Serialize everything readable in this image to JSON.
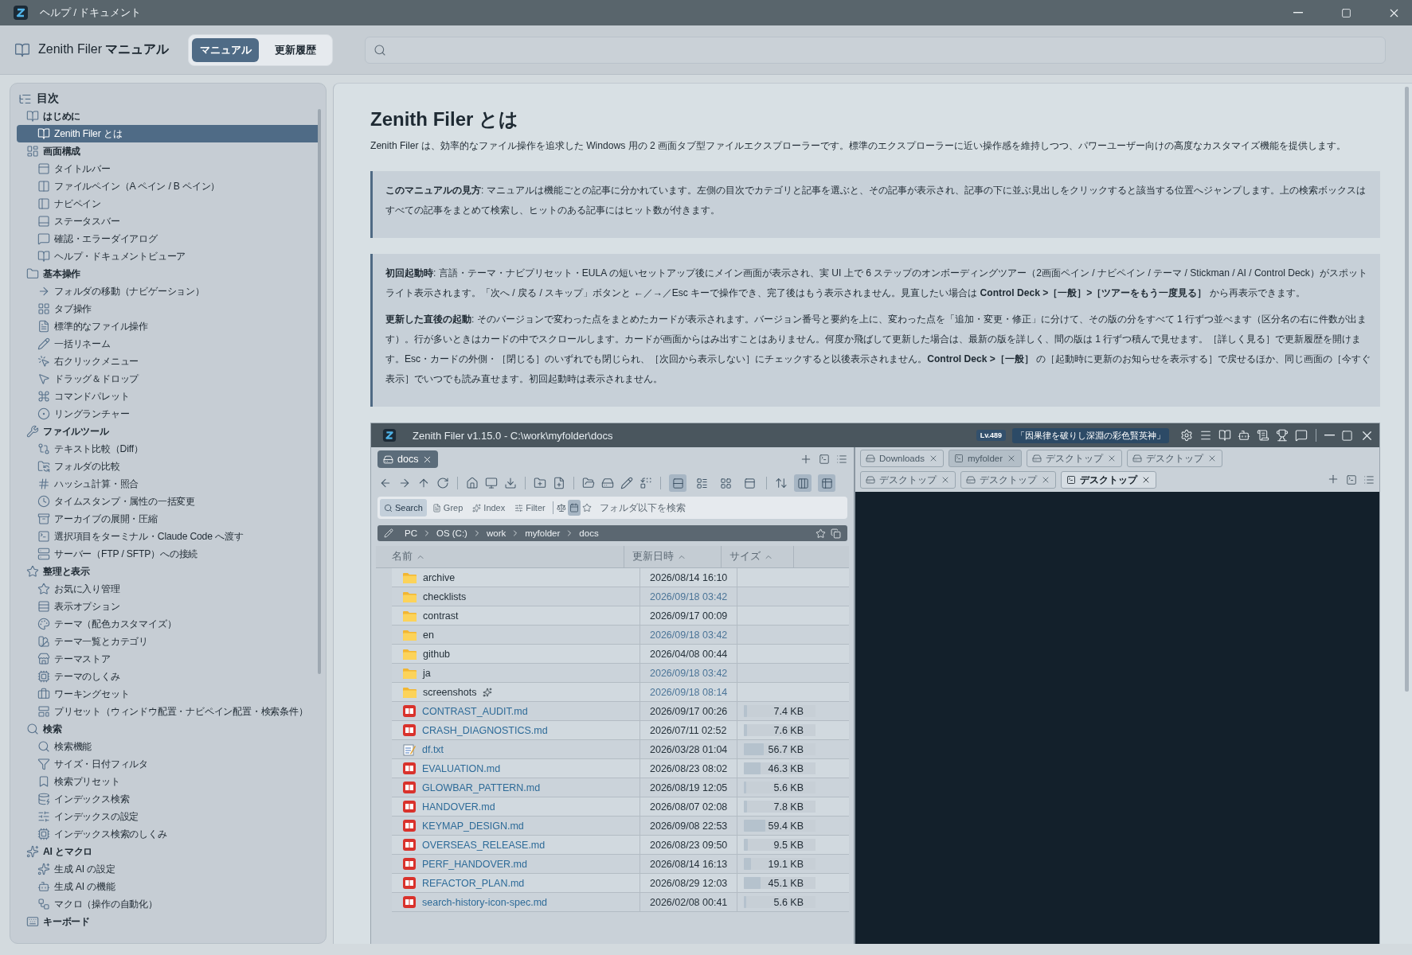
{
  "window": {
    "title": "ヘルプ / ドキュメント"
  },
  "header": {
    "title": "Zenith Filer **マニュアル**"
  },
  "tabs": [
    {
      "label": "マニュアル",
      "selected": true
    },
    {
      "label": "更新履歴",
      "selected": false
    }
  ],
  "toc": {
    "title": "目次",
    "sections": [
      {
        "label": "はじめに",
        "children": [
          {
            "label": "Zenith Filer とは",
            "selected": true
          }
        ]
      },
      {
        "label": "画面構成",
        "children": [
          {
            "label": "タイトルバー",
            "selected": false
          },
          {
            "label": "ファイルペイン（A ペイン / B ペイン）",
            "selected": false
          },
          {
            "label": "ナビペイン",
            "selected": false
          },
          {
            "label": "ステータスバー",
            "selected": false
          },
          {
            "label": "確認・エラーダイアログ",
            "selected": false
          },
          {
            "label": "ヘルプ・ドキュメントビューア",
            "selected": false
          }
        ]
      },
      {
        "label": "基本操作",
        "children": [
          {
            "label": "フォルダの移動（ナビゲーション）",
            "selected": false
          },
          {
            "label": "タブ操作",
            "selected": false
          },
          {
            "label": "標準的なファイル操作",
            "selected": false
          },
          {
            "label": "一括リネーム",
            "selected": false
          },
          {
            "label": "右クリックメニュー",
            "selected": false
          },
          {
            "label": "ドラッグ＆ドロップ",
            "selected": false
          },
          {
            "label": "コマンドパレット",
            "selected": false
          },
          {
            "label": "リングランチャー",
            "selected": false
          }
        ]
      },
      {
        "label": "ファイルツール",
        "children": [
          {
            "label": "テキスト比較（Diff）",
            "selected": false
          },
          {
            "label": "フォルダの比較",
            "selected": false
          },
          {
            "label": "ハッシュ計算・照合",
            "selected": false
          },
          {
            "label": "タイムスタンプ・属性の一括変更",
            "selected": false
          },
          {
            "label": "アーカイブの展開・圧縮",
            "selected": false
          },
          {
            "label": "選択項目をターミナル・Claude Code へ渡す",
            "selected": false
          },
          {
            "label": "サーバー（FTP / SFTP）への接続",
            "selected": false
          }
        ]
      },
      {
        "label": "整理と表示",
        "children": [
          {
            "label": "お気に入り管理",
            "selected": false
          },
          {
            "label": "表示オプション",
            "selected": false
          },
          {
            "label": "テーマ（配色カスタマイズ）",
            "selected": false
          },
          {
            "label": "テーマ一覧とカテゴリ",
            "selected": false
          },
          {
            "label": "テーマストア",
            "selected": false
          },
          {
            "label": "テーマのしくみ",
            "selected": false
          },
          {
            "label": "ワーキングセット",
            "selected": false
          },
          {
            "label": "プリセット（ウィンドウ配置・ナビペイン配置・検索条件）",
            "selected": false
          }
        ]
      },
      {
        "label": "検索",
        "children": [
          {
            "label": "検索機能",
            "selected": false
          },
          {
            "label": "サイズ・日付フィルタ",
            "selected": false
          },
          {
            "label": "検索プリセット",
            "selected": false
          },
          {
            "label": "インデックス検索",
            "selected": false
          },
          {
            "label": "インデックスの設定",
            "selected": false
          },
          {
            "label": "インデックス検索のしくみ",
            "selected": false
          }
        ]
      },
      {
        "label": "AI とマクロ",
        "children": [
          {
            "label": "生成 AI の設定",
            "selected": false
          },
          {
            "label": "生成 AI の機能",
            "selected": false
          },
          {
            "label": "マクロ（操作の自動化）",
            "selected": false
          }
        ]
      },
      {
        "label": "キーボード"
      }
    ]
  },
  "article": {
    "title": "Zenith Filer とは",
    "intro": "Zenith Filer は、効率的なファイル操作を追求した Windows 用の 2 画面タブ型ファイルエクスプローラーです。標準のエクスプローラーに近い操作感を維持しつつ、パワーユーザー向けの高度なカスタマイズ機能を提供します。",
    "callouts": [
      {
        "paragraphs": [
          "**このマニュアルの見方**: マニュアルは機能ごとの記事に分かれています。左側の目次でカテゴリと記事を選ぶと、その記事が表示され、記事の下に並ぶ見出しをクリックすると該当する位置へジャンプします。上の検索ボックスはすべての記事をまとめて検索し、ヒットのある記事にはヒット数が付きます。"
        ]
      },
      {
        "paragraphs": [
          "**初回起動時**: 言語・テーマ・ナビプリセット・EULA の短いセットアップ後にメイン画面が表示され、実 UI 上で 6 ステップのオンボーディングツアー（2画面ペイン / ナビペイン / テーマ / Stickman / AI / Control Deck）がスポットライト表示されます。「次へ / 戻る / スキップ」ボタンと ←／→／Esc キーで操作でき、完了後はもう表示されません。見直したい場合は **Control Deck >［一般］>［ツアーをもう一度見る］** から再表示できます。",
          "**更新した直後の起動**: そのバージョンで変わった点をまとめたカードが表示されます。バージョン番号と要約を上に、変わった点を「追加・変更・修正」に分けて、その版の分をすべて 1 行ずつ並べます（区分名の右に件数が出ます）。行が多いときはカードの中でスクロールします。カードが画面からはみ出すことはありません。何度か飛ばして更新した場合は、最新の版を詳しく、間の版は 1 行ずつ積んで見せます。［詳しく見る］で更新履歴を開けます。Esc・カードの外側・［閉じる］のいずれでも閉じられ、［次回から表示しない］にチェックすると以後表示されません。**Control Deck >［一般］** の［起動時に更新のお知らせを表示する］で戻せるほか、同じ画面の［今すぐ表示］でいつでも読み直せます。初回起動時は表示されません。"
        ]
      }
    ],
    "screenshot": {
      "title": "Zenith Filer v1.15.0 - C:\\work\\myfolder\\docs",
      "level_badge": "Lv.489",
      "title_badge": "「因果律を破りし深淵の彩色賢英神」",
      "left_pane": {
        "tabs": [
          {
            "label": "docs",
            "selected": true
          }
        ],
        "view_modes": [
          {
            "selected": true
          },
          {
            "selected": false
          },
          {
            "selected": false
          },
          {
            "selected": false
          }
        ],
        "toggles": [
          {
            "on": true
          },
          {
            "on": true
          }
        ],
        "search_modes": [
          {
            "label": "Search",
            "selected": true
          },
          {
            "label": "Grep",
            "selected": false
          },
          {
            "label": "Index",
            "selected": false
          },
          {
            "label": "Filter",
            "selected": false
          }
        ],
        "date_filter_on": true,
        "search_placeholder": "フォルダ以下を検索",
        "breadcrumb": [
          "PC",
          "OS (C:)",
          "work",
          "myfolder",
          "docs"
        ],
        "columns": [
          "名前",
          "更新日時",
          "サイズ"
        ],
        "rows": [
          {
            "kind": "folder",
            "name": "archive",
            "date": "2026/08/14 16:10",
            "recent": false,
            "flagged": false
          },
          {
            "kind": "folder",
            "name": "checklists",
            "date": "2026/09/18 03:42",
            "recent": true,
            "flagged": false
          },
          {
            "kind": "folder",
            "name": "contrast",
            "date": "2026/09/17 00:09",
            "recent": false,
            "flagged": false
          },
          {
            "kind": "folder",
            "name": "en",
            "date": "2026/09/18 03:42",
            "recent": true,
            "flagged": false
          },
          {
            "kind": "folder",
            "name": "github",
            "date": "2026/04/08 00:44",
            "recent": false,
            "flagged": false
          },
          {
            "kind": "folder",
            "name": "ja",
            "date": "2026/09/18 03:42",
            "recent": true,
            "flagged": false
          },
          {
            "kind": "folder",
            "name": "screenshots",
            "date": "2026/09/18 08:14",
            "recent": true,
            "flagged": true
          },
          {
            "kind": "markdown",
            "name": "CONTRAST_AUDIT.md",
            "date": "2026/09/17 00:26",
            "recent": false,
            "flagged": false,
            "size": "7.4 KB",
            "level": 0.04
          },
          {
            "kind": "markdown",
            "name": "CRASH_DIAGNOSTICS.md",
            "date": "2026/07/11 02:52",
            "recent": false,
            "flagged": false,
            "size": "7.6 KB",
            "level": 0.04
          },
          {
            "kind": "text",
            "name": "df.txt",
            "date": "2026/03/28 01:04",
            "recent": false,
            "flagged": false,
            "size": "56.7 KB",
            "level": 0.28
          },
          {
            "kind": "markdown",
            "name": "EVALUATION.md",
            "date": "2026/08/23 08:02",
            "recent": false,
            "flagged": false,
            "size": "46.3 KB",
            "level": 0.23
          },
          {
            "kind": "markdown",
            "name": "GLOWBAR_PATTERN.md",
            "date": "2026/08/19 12:05",
            "recent": false,
            "flagged": false,
            "size": "5.6 KB",
            "level": 0.03
          },
          {
            "kind": "markdown",
            "name": "HANDOVER.md",
            "date": "2026/08/07 02:08",
            "recent": false,
            "flagged": false,
            "size": "7.8 KB",
            "level": 0.04
          },
          {
            "kind": "markdown",
            "name": "KEYMAP_DESIGN.md",
            "date": "2026/09/08 22:53",
            "recent": false,
            "flagged": false,
            "size": "59.4 KB",
            "level": 0.3
          },
          {
            "kind": "markdown",
            "name": "OVERSEAS_RELEASE.md",
            "date": "2026/08/23 09:50",
            "recent": false,
            "flagged": false,
            "size": "9.5 KB",
            "level": 0.05
          },
          {
            "kind": "markdown",
            "name": "PERF_HANDOVER.md",
            "date": "2026/08/14 16:13",
            "recent": false,
            "flagged": false,
            "size": "19.1 KB",
            "level": 0.1
          },
          {
            "kind": "markdown",
            "name": "REFACTOR_PLAN.md",
            "date": "2026/08/29 12:03",
            "recent": false,
            "flagged": false,
            "size": "45.1 KB",
            "level": 0.23
          },
          {
            "kind": "markdown",
            "name": "search-history-icon-spec.md",
            "date": "2026/02/08 00:41",
            "recent": false,
            "flagged": false,
            "size": "5.6 KB",
            "level": 0.03
          }
        ]
      },
      "right_pane": {
        "tabs": [
          {
            "kind": "drive",
            "label": "Downloads",
            "selected": false
          },
          {
            "kind": "terminal",
            "label": "myfolder",
            "selected": false
          },
          {
            "kind": "drive",
            "label": "デスクトップ",
            "selected": false
          },
          {
            "kind": "drive",
            "label": "デスクトップ",
            "selected": false
          },
          {
            "kind": "drive",
            "label": "デスクトップ",
            "selected": false
          },
          {
            "kind": "drive",
            "label": "デスクトップ",
            "selected": false
          },
          {
            "kind": "terminal",
            "label": "デスクトップ",
            "selected": true
          }
        ]
      }
    }
  }
}
